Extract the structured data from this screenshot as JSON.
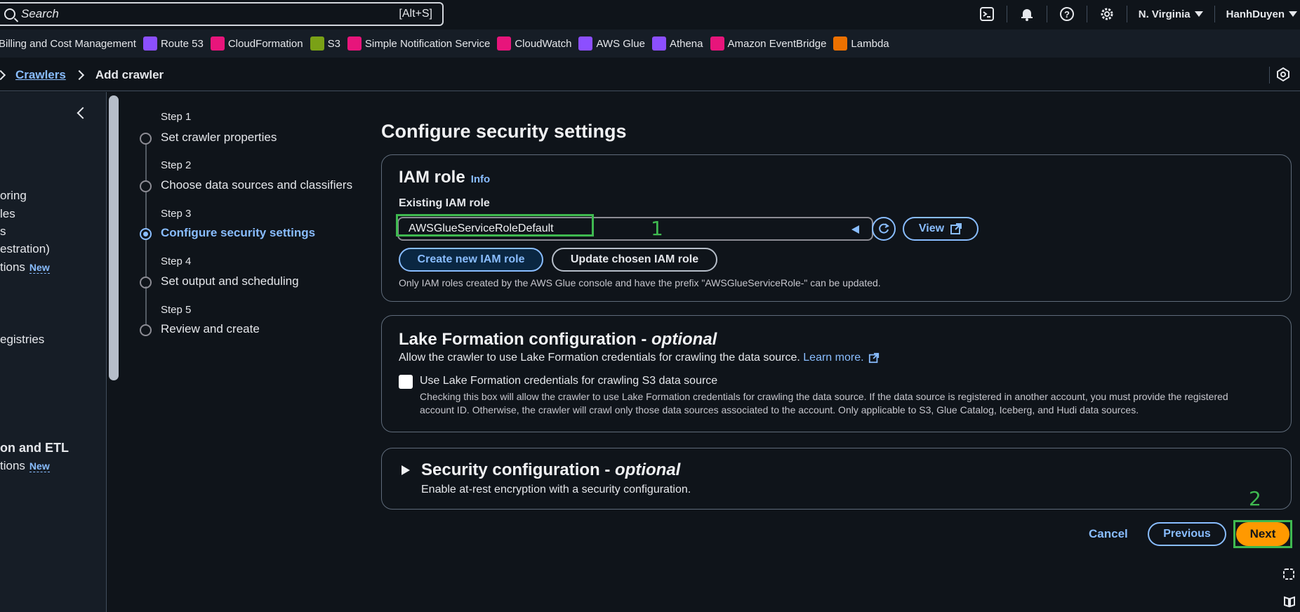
{
  "topnav": {
    "search_placeholder": "Search",
    "search_shortcut": "[Alt+S]",
    "region": "N. Virginia",
    "user": "HanhDuyen"
  },
  "favorites": [
    {
      "label": "Billing and Cost Management",
      "color": ""
    },
    {
      "label": "Route 53",
      "color": "#8c4fff"
    },
    {
      "label": "CloudFormation",
      "color": "#e7157b"
    },
    {
      "label": "S3",
      "color": "#7aa116"
    },
    {
      "label": "Simple Notification Service",
      "color": "#e7157b"
    },
    {
      "label": "CloudWatch",
      "color": "#e7157b"
    },
    {
      "label": "AWS Glue",
      "color": "#8c4fff"
    },
    {
      "label": "Athena",
      "color": "#8c4fff"
    },
    {
      "label": "Amazon EventBridge",
      "color": "#e7157b"
    },
    {
      "label": "Lambda",
      "color": "#ed7100"
    }
  ],
  "breadcrumb": {
    "link": "Crawlers",
    "current": "Add crawler"
  },
  "sidebar": {
    "items": [
      "oring",
      "les",
      "s",
      "estration)",
      "tions",
      "egistries"
    ],
    "new_badge": "New",
    "section_heading": "on and ETL",
    "section_item": "tions"
  },
  "steps": [
    {
      "num": "Step 1",
      "title": "Set crawler properties"
    },
    {
      "num": "Step 2",
      "title": "Choose data sources and classifiers"
    },
    {
      "num": "Step 3",
      "title": "Configure security settings"
    },
    {
      "num": "Step 4",
      "title": "Set output and scheduling"
    },
    {
      "num": "Step 5",
      "title": "Review and create"
    }
  ],
  "main": {
    "title": "Configure security settings",
    "iam": {
      "title": "IAM role",
      "info": "Info",
      "field_label": "Existing IAM role",
      "selected_role": "AWSGlueServiceRoleDefault",
      "view_label": "View",
      "create_label": "Create new IAM role",
      "update_label": "Update chosen IAM role",
      "help": "Only IAM roles created by the AWS Glue console and have the prefix \"AWSGlueServiceRole-\" can be updated."
    },
    "lake": {
      "title": "Lake Formation configuration - ",
      "title_optional": "optional",
      "desc": "Allow the crawler to use Lake Formation credentials for crawling the data source.",
      "learn_more": "Learn more.",
      "checkbox_label": "Use Lake Formation credentials for crawling S3 data source",
      "checkbox_desc": "Checking this box will allow the crawler to use Lake Formation credentials for crawling the data source. If the data source is registered in another account, you must provide the registered account ID. Otherwise, the crawler will crawl only those data sources associated to the account. Only applicable to S3, Glue Catalog, Iceberg, and Hudi data sources."
    },
    "security": {
      "title": "Security configuration - ",
      "title_optional": "optional",
      "desc": "Enable at-rest encryption with a security configuration."
    },
    "actions": {
      "cancel": "Cancel",
      "previous": "Previous",
      "next": "Next"
    },
    "annotations": {
      "first": "1",
      "second": "2"
    }
  }
}
